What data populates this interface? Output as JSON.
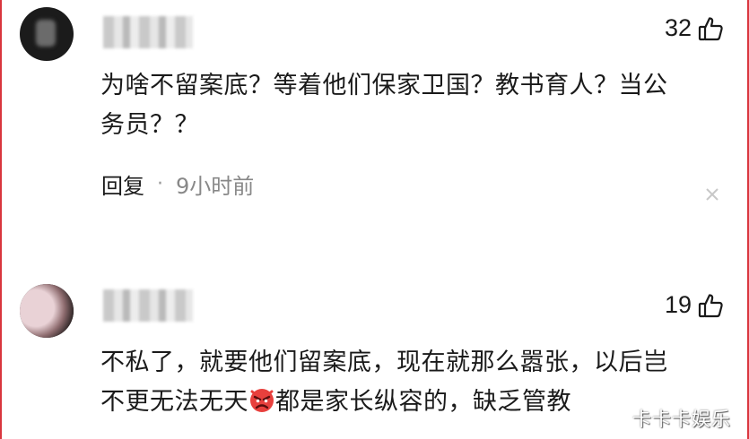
{
  "comments": [
    {
      "likes": "32",
      "content": "为啥不留案底？等着他们保家卫国？教书育人？当公\n务员？？",
      "reply_label": "回复",
      "separator": "·",
      "time": "9小时前"
    },
    {
      "likes": "19",
      "content_part1": "不私了，就要他们留案底，现在就那么嚣张，以后岂\n不更无法无天",
      "emoji": "angry-face-icon",
      "content_part2": "都是家长纵容的，缺乏管教"
    }
  ],
  "watermark": "卡卡卡娱乐",
  "colors": {
    "frame": "#d9363e",
    "text": "#1a1a1a",
    "muted": "#888888"
  }
}
